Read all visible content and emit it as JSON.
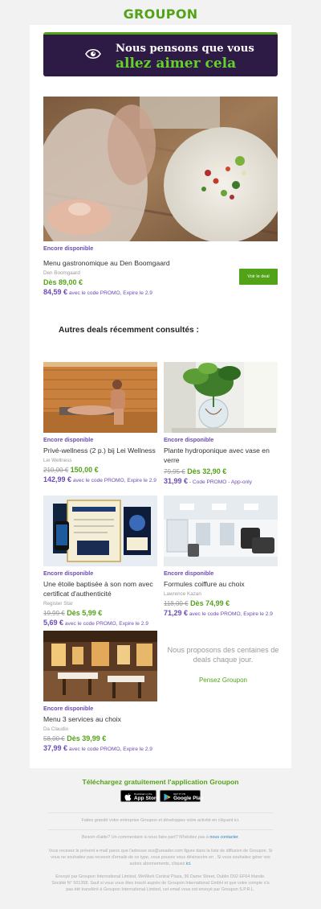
{
  "brand": {
    "logo": "GROUPON"
  },
  "banner": {
    "line1": "Nous pensons que vous",
    "line2": "allez aimer cela"
  },
  "hero": {
    "availability": "Encore disponible",
    "title": "Menu gastronomique au Den Boomgaard",
    "merchant": "Den Boomgaard",
    "price": "Dès 89,00 €",
    "promo_price": "84,59 €",
    "promo_text": "avec le code PROMO, Expire le 2.9",
    "cta": "Voir le deal"
  },
  "recent": {
    "heading": "Autres deals récemment consultés :",
    "deals": [
      {
        "availability": "Encore disponible",
        "title": "Privé-wellness (2 p.) bij Lei Wellness",
        "merchant": "Lei Wellness",
        "old_price": "210,00 €",
        "price": "150,00 €",
        "promo_price": "142,99 €",
        "promo_text": "avec le code PROMO, Expire le 2.9"
      },
      {
        "availability": "Encore disponible",
        "title": "Plante hydroponique avec vase en verre",
        "merchant": "",
        "old_price": "79,95 €",
        "price": "Dès 32,90 €",
        "promo_price": "31,99 €",
        "promo_text": "- Code PROMO - App-only"
      },
      {
        "availability": "Encore disponible",
        "title": "Une étoile baptisée à son nom avec certificat d'authenticité",
        "merchant": "Register Star",
        "old_price": "19,99 €",
        "price": "Dès 5,99 €",
        "promo_price": "5,69 €",
        "promo_text": "avec le code PROMO, Expire le 2.9"
      },
      {
        "availability": "Encore disponible",
        "title": "Formules coiffure au choix",
        "merchant": "Lawrence Kazan",
        "old_price": "118,00 €",
        "price": "Dès 74,99 €",
        "promo_price": "71,29 €",
        "promo_text": "avec le code PROMO, Expire le 2.9"
      },
      {
        "availability": "Encore disponible",
        "title": "Menu 3 services au choix",
        "merchant": "Da Claudio",
        "old_price": "58,00 €",
        "price": "Dès 39,99 €",
        "promo_price": "37,99 €",
        "promo_text": "avec le code PROMO, Expire le 2.9"
      }
    ],
    "more_text": "Nous proposons des centaines de deals chaque jour.",
    "more_link": "Pensez Groupon"
  },
  "app": {
    "title": "Téléchargez gratuitement l'application Groupon",
    "appstore_small": "Download on the",
    "appstore_big": "App Store",
    "gplay_small": "GET IT ON",
    "gplay_big": "Google Play"
  },
  "footer": {
    "p1": "Faites grandir votre entreprise Groupon et développez votre activité en cliquant ici.",
    "p2_text": "Besoin d'aide? Un commentaire à nous faire part? N'hésitez pas à",
    "p2_link": "nous contacter.",
    "p3_text": "Vous recevez le présent e-mail parce que l'adresse xxx@ureader.com figure dans la liste de diffusion de Groupon. Si vous ne souhaitez pas recevoir d'emails de ce type, vous pouvez vous désinscrire en . Si vous souhaitez gérer vos autres abonnements, cliquez",
    "p3_link": "ici.",
    "p4": "Envoyé par Groupon International Limited, WeWork Central Plaza, 36 Dame Street, Dublin D02 EF64 Irlande. Société N° 501358. Sauf si vous vous êtes inscrit auprès de Groupon International GmbH et que votre compte n'a pas été transféré à Groupon International Limited, cet email vous est envoyé par Groupon S.P.R.L."
  },
  "colors": {
    "brand_green": "#53a318",
    "banner_bg": "#2d1b45",
    "promo_purple": "#6b4bb5"
  },
  "icons": [
    "eye-icon",
    "apple-icon",
    "google-play-icon"
  ]
}
